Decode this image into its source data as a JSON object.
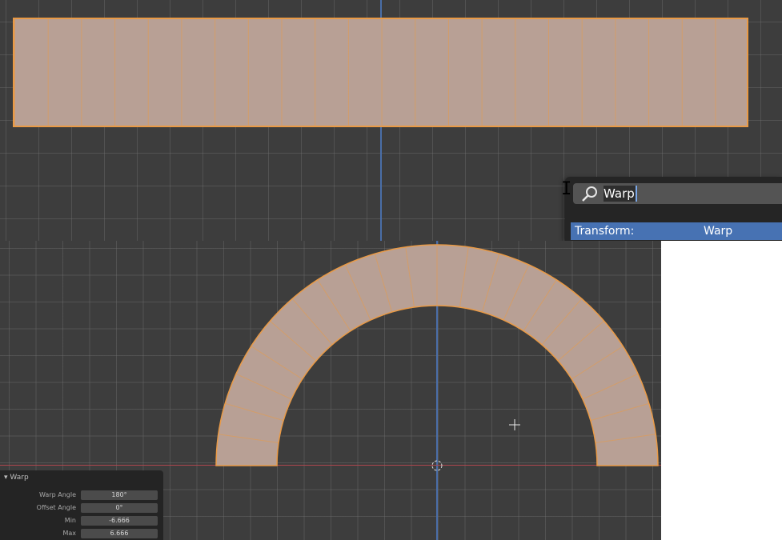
{
  "colors": {
    "viewport_bg": "#3d3d3d",
    "mesh_fill": "#b8a095",
    "mesh_edge": "#e99a46",
    "axis_z": "#4a6ea8",
    "axis_x": "#b0474e",
    "highlight": "#4772b3"
  },
  "search": {
    "icon": "search-icon",
    "query": "Warp",
    "result_category": "Transform:",
    "result_name": "Warp"
  },
  "operator": {
    "title": "Warp",
    "fields": [
      {
        "label": "Warp Angle",
        "value": "180°"
      },
      {
        "label": "Offset Angle",
        "value": "0°"
      },
      {
        "label": "Min",
        "value": "-6.666"
      },
      {
        "label": "Max",
        "value": "6.666"
      }
    ]
  }
}
